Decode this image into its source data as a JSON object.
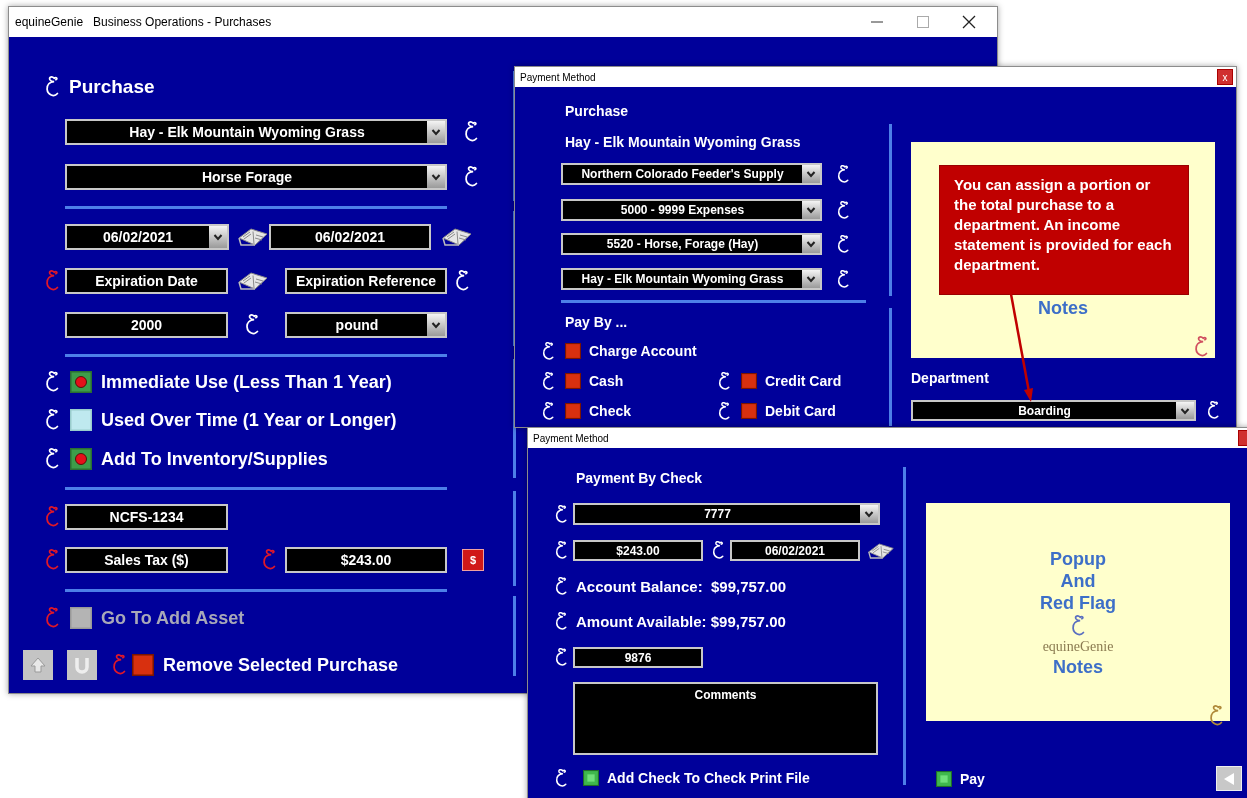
{
  "main_window": {
    "title": "equineGenie   Business Operations - Purchases",
    "heading": {
      "text": "Purchase",
      "flagged": false
    },
    "item": {
      "value": "Hay - Elk Mountain Wyoming Grass",
      "flagged": false
    },
    "category": {
      "value": "Horse Forage",
      "flagged": false
    },
    "purchase_date": "06/02/2021",
    "entry_date": "06/02/2021",
    "expiration_date": {
      "placeholder": "Expiration Date",
      "flagged": true
    },
    "expiration_reference": {
      "placeholder": "Expiration Reference",
      "flagged": false
    },
    "quantity": {
      "value": "2000",
      "flagged": false
    },
    "unit": "pound",
    "options": [
      {
        "label": "Immediate Use (Less Than 1 Year)",
        "checked": true,
        "flagged": false
      },
      {
        "label": "Used Over Time (1 Year or Longer)",
        "checked": false,
        "flagged": false
      },
      {
        "label": "Add To Inventory/Supplies",
        "checked": true,
        "flagged": false
      }
    ],
    "invoice": {
      "value": "NCFS-1234",
      "flagged": true
    },
    "sales_tax": {
      "placeholder": "Sales Tax ($)",
      "flagged": true
    },
    "amount": {
      "value": "$243.00",
      "flagged": true
    },
    "amount_button": "$",
    "add_asset": {
      "label": "Go To Add Asset",
      "disabled": true,
      "flagged": true
    },
    "remove": {
      "label": "Remove Selected Purchase",
      "checked": false,
      "flagged": true
    }
  },
  "payment_window": {
    "title": "Payment Method",
    "close": "x",
    "heading": "Purchase",
    "item": "Hay - Elk Mountain Wyoming Grass",
    "selects": [
      {
        "value": "Northern Colorado Feeder's Supply",
        "flagged": false
      },
      {
        "value": "5000 - 9999 Expenses",
        "flagged": false
      },
      {
        "value": "5520 - Horse, Forage (Hay)",
        "flagged": false
      },
      {
        "value": "Hay - Elk Mountain Wyoming Grass",
        "flagged": false
      }
    ],
    "pay_by_label": "Pay By ...",
    "pay_by": [
      {
        "label": "Charge Account",
        "checked": false,
        "flagged": false
      },
      {
        "label": "Cash",
        "checked": false,
        "flagged": false
      },
      {
        "label": "Credit Card",
        "checked": false,
        "flagged": false
      },
      {
        "label": "Check",
        "checked": false,
        "flagged": false
      },
      {
        "label": "Debit Card",
        "checked": false,
        "flagged": false
      }
    ],
    "notes": "Notes",
    "department_label": "Department",
    "department": {
      "value": "Boarding",
      "flagged": false
    },
    "callout": "You can assign a portion or the total purchase to a department. An income statement is provided for each department."
  },
  "check_window": {
    "title": "Payment Method",
    "heading": "Payment By Check",
    "account": {
      "value": "7777",
      "flagged": false
    },
    "amount": {
      "value": "$243.00",
      "flagged": false
    },
    "date": {
      "value": "06/02/2021",
      "flagged": false
    },
    "balance": {
      "text": "Account Balance:  $99,757.00",
      "flagged": false
    },
    "available": {
      "text": "Amount Available: $99,757.00",
      "flagged": false
    },
    "check_number": {
      "value": "9876",
      "flagged": false
    },
    "comments": {
      "placeholder": "Comments"
    },
    "print": {
      "label": "Add Check To Check Print File",
      "checked": false,
      "flagged": false
    },
    "notes": [
      "Popup",
      "And",
      "Red Flag"
    ],
    "logo": "equineGenie",
    "notes_footer": "Notes",
    "pay": {
      "label": "Pay",
      "checked": false
    }
  }
}
